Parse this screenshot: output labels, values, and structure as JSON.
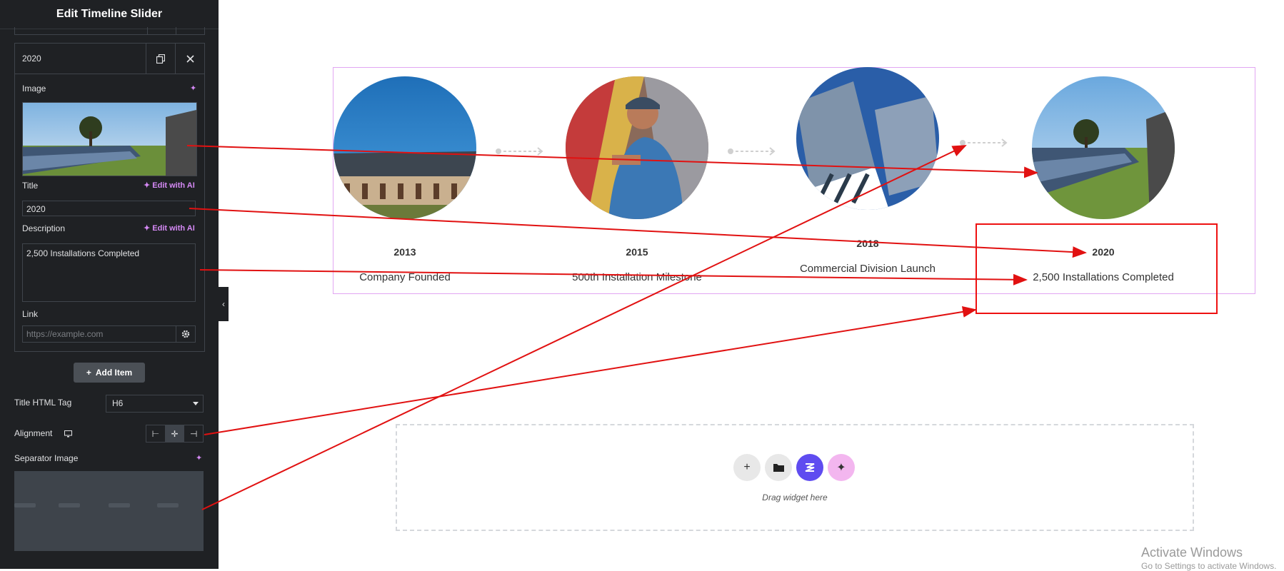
{
  "panel": {
    "title": "Edit Timeline Slider",
    "item": {
      "title": "2020",
      "image_label": "Image",
      "title_label": "Title",
      "title_value": "2020",
      "description_label": "Description",
      "description_value": "2,500 Installations Completed",
      "edit_with_ai": "Edit with AI",
      "link_label": "Link",
      "link_placeholder": "https://example.com"
    },
    "add_item_label": "Add Item",
    "title_html_tag_label": "Title HTML Tag",
    "title_html_tag_value": "H6",
    "alignment_label": "Alignment",
    "separator_image_label": "Separator Image"
  },
  "timeline": {
    "items": [
      {
        "year": "2013",
        "description": "Company Founded"
      },
      {
        "year": "2015",
        "description": "500th Installation Milestone"
      },
      {
        "year": "2018",
        "description": "Commercial Division Launch"
      },
      {
        "year": "2020",
        "description": "2,500 Installations Completed"
      }
    ]
  },
  "canvas": {
    "drop_caption": "Drag widget here"
  },
  "watermark": {
    "title": "Activate Windows",
    "subtitle": "Go to Settings to activate Windows."
  },
  "colors": {
    "panel_bg": "#1f2124",
    "accent_ai": "#d589f5",
    "frame_border": "#e2a6f2",
    "annotation_red": "#e11111",
    "elementor_purple": "#5f4cf0"
  }
}
